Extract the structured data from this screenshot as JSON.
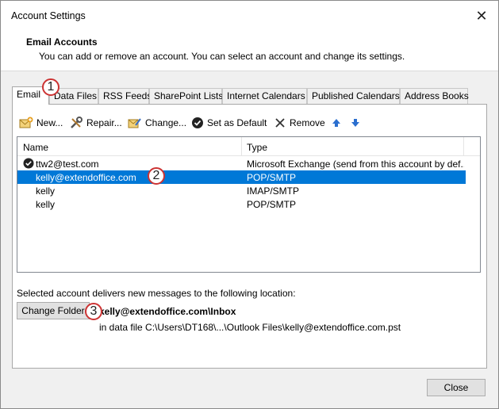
{
  "window": {
    "title": "Account Settings"
  },
  "header": {
    "title": "Email Accounts",
    "description": "You can add or remove an account. You can select an account and change its settings."
  },
  "tabs": [
    {
      "label": "Email",
      "active": true
    },
    {
      "label": "Data Files"
    },
    {
      "label": "RSS Feeds"
    },
    {
      "label": "SharePoint Lists"
    },
    {
      "label": "Internet Calendars"
    },
    {
      "label": "Published Calendars"
    },
    {
      "label": "Address Books"
    }
  ],
  "toolbar": {
    "new_label": "New...",
    "repair_label": "Repair...",
    "change_label": "Change...",
    "set_default_label": "Set as Default",
    "remove_label": "Remove"
  },
  "list": {
    "columns": [
      "Name",
      "Type"
    ],
    "rows": [
      {
        "name": "ttw2@test.com",
        "type": "Microsoft Exchange (send from this account by def...",
        "default": true
      },
      {
        "name": "kelly@extendoffice.com",
        "type": "POP/SMTP",
        "selected": true
      },
      {
        "name": "kelly",
        "type": "IMAP/SMTP"
      },
      {
        "name": "kelly",
        "type": "POP/SMTP"
      }
    ]
  },
  "delivery": {
    "description": "Selected account delivers new messages to the following location:",
    "change_folder_label": "Change Folder",
    "folder_path": "kelly@extendoffice.com\\Inbox",
    "data_file": "in data file C:\\Users\\DT168\\...\\Outlook Files\\kelly@extendoffice.com.pst"
  },
  "footer": {
    "close_label": "Close"
  },
  "annotations": [
    "1",
    "2",
    "3"
  ],
  "colors": {
    "selection": "#0078d7",
    "annotation_border": "#cc3333",
    "arrow_blue": "#2b6fcf"
  }
}
